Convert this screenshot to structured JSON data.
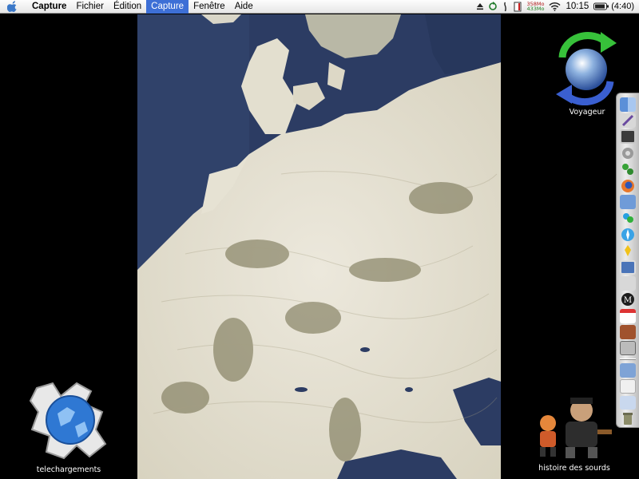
{
  "menubar": {
    "app_menu": "Capture",
    "menus": [
      "Fichier",
      "Édition",
      "Capture",
      "Fenêtre",
      "Aide"
    ],
    "active_menu": "Capture",
    "memory_top": "358Mo",
    "memory_bottom": "433Mo",
    "clock": "10:15",
    "battery_text": "(4:40)"
  },
  "desktop": {
    "icons": {
      "voyageur": "Voyageur",
      "telechargements": "telechargements",
      "histoire": "histoire des sourds"
    }
  },
  "dock": {
    "items": [
      "finder-icon",
      "graphics-icon",
      "terminal-icon",
      "system-prefs-icon",
      "network-icon",
      "firefox-icon",
      "preview-icon",
      "messenger-icon",
      "safari-icon",
      "aim-icon",
      "photo-icon",
      "app-icon",
      "mwm-icon",
      "ical-icon",
      "dictionary-icon",
      "prefs-icon",
      "applications-folder-icon",
      "documents-folder-icon",
      "downloads-folder-icon",
      "trash-icon"
    ]
  },
  "colors": {
    "menubar_active": "#3d6fd6",
    "sea": "#2b3b62",
    "snow": "#e6e1d2",
    "land_dark": "#6e6a48"
  }
}
